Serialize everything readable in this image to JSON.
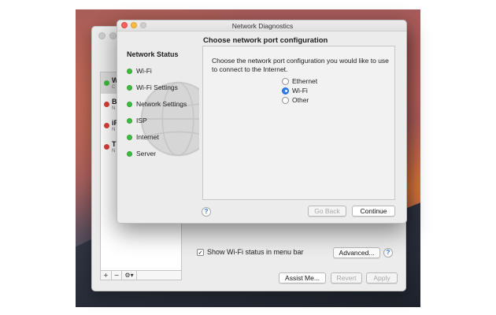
{
  "back_window": {
    "services": [
      {
        "name": "W",
        "sub": "C",
        "status_color": "#3dbd3d",
        "selected": true
      },
      {
        "name": "B",
        "sub": "N",
        "status_color": "#d8413a",
        "selected": false
      },
      {
        "name": "iP",
        "sub": "N",
        "status_color": "#d8413a",
        "selected": false
      },
      {
        "name": "Tl",
        "sub": "N",
        "status_color": "#d8413a",
        "selected": false
      }
    ],
    "list_tools": {
      "add": "+",
      "remove": "−",
      "gear": "⚙▾"
    },
    "show_wifi_label": "Show Wi-Fi status in menu bar",
    "show_wifi_checked": "✓",
    "advanced_label": "Advanced...",
    "help": "?",
    "assist_label": "Assist Me...",
    "revert_label": "Revert",
    "apply_label": "Apply"
  },
  "front_window": {
    "title": "Network Diagnostics",
    "status_heading": "Network Status",
    "status_items": [
      {
        "label": "Wi-Fi",
        "color": "#3dbd3d"
      },
      {
        "label": "Wi-Fi Settings",
        "color": "#3dbd3d"
      },
      {
        "label": "Network Settings",
        "color": "#3dbd3d"
      },
      {
        "label": "ISP",
        "color": "#3dbd3d"
      },
      {
        "label": "Internet",
        "color": "#3dbd3d"
      },
      {
        "label": "Server",
        "color": "#3dbd3d"
      }
    ],
    "main_title": "Choose network port configuration",
    "description": "Choose the network port configuration you would like to use to connect to the Internet.",
    "options": [
      {
        "label": "Ethernet",
        "selected": false
      },
      {
        "label": "Wi-Fi",
        "selected": true
      },
      {
        "label": "Other",
        "selected": false
      }
    ],
    "help": "?",
    "go_back_label": "Go Back",
    "continue_label": "Continue"
  }
}
